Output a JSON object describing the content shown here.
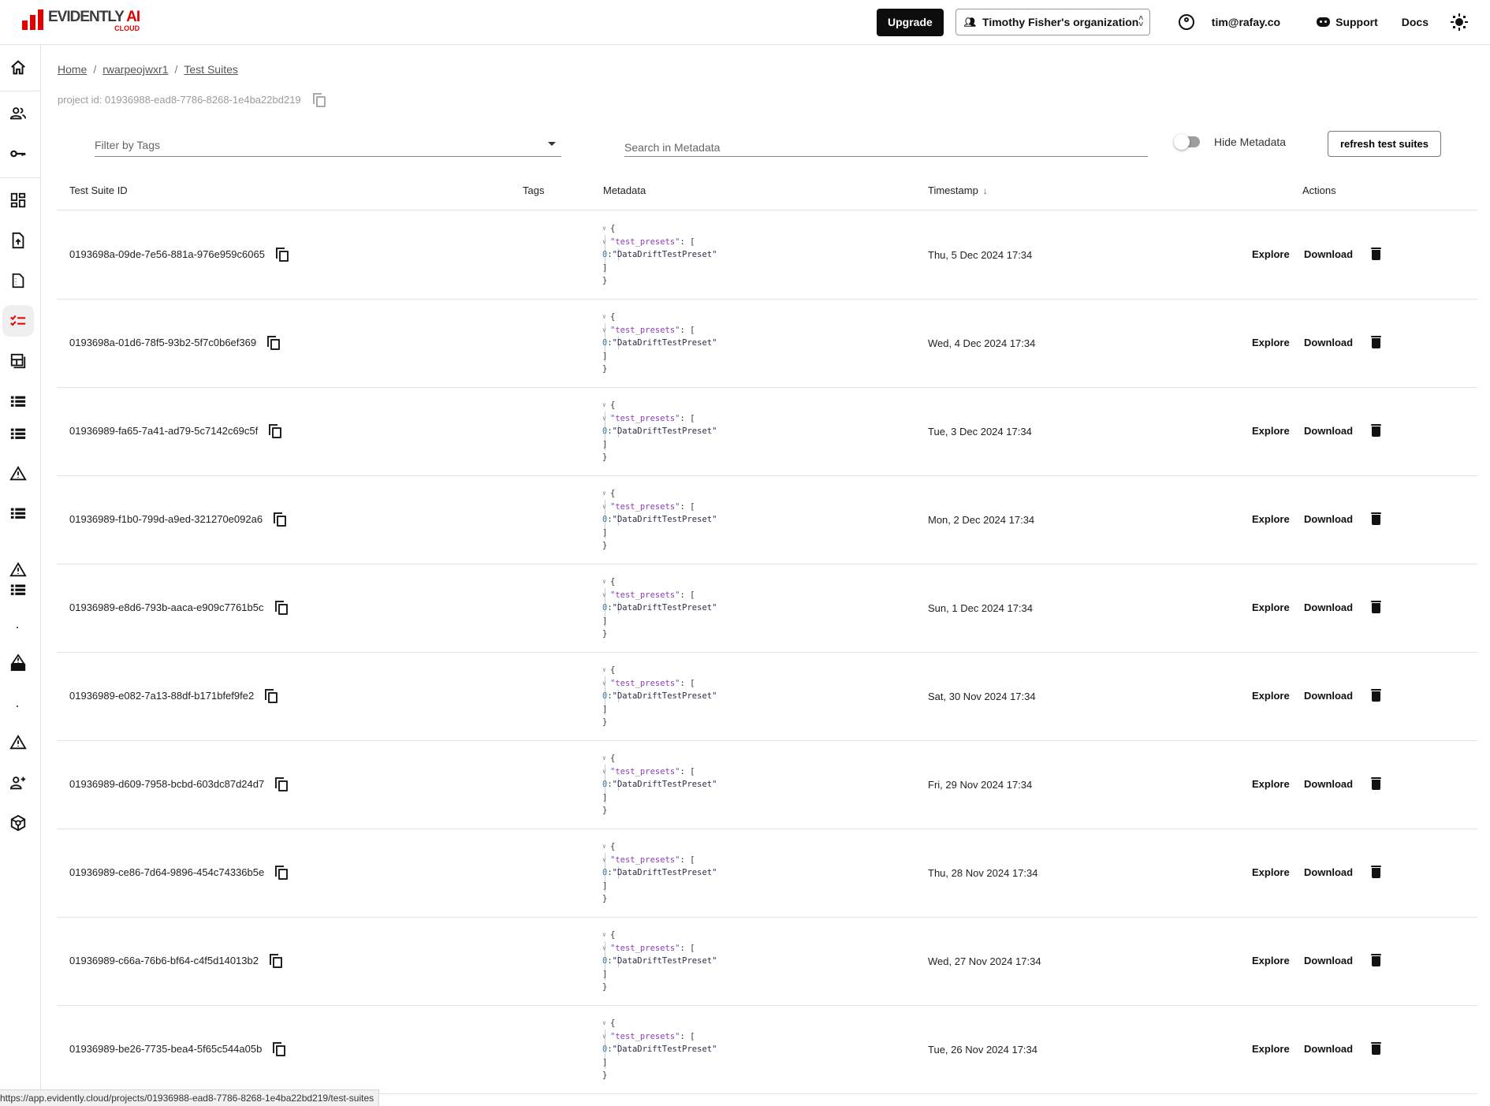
{
  "header": {
    "logo": {
      "main": "EVIDENTLY",
      "accent": "AI",
      "sub": "CLOUD",
      "brand_color": "#e10000"
    },
    "upgrade_label": "Upgrade",
    "org_selector": {
      "icon": "group-icon",
      "label": "Timothy Fisher's organization"
    },
    "account_email": "tim@rafay.co",
    "support_label": "Support",
    "docs_label": "Docs",
    "theme_icon": "sun-icon"
  },
  "sidebar": {
    "items": [
      {
        "name": "home",
        "icon": "home-icon"
      },
      {
        "name": "users",
        "icon": "users-icon"
      },
      {
        "name": "api-keys",
        "icon": "key-icon"
      },
      {
        "name": "dashboard",
        "icon": "dashboard-icon"
      },
      {
        "name": "reports",
        "icon": "upload-file-icon"
      },
      {
        "name": "datasets",
        "icon": "file-icon"
      },
      {
        "name": "test-suites",
        "icon": "checklist-icon",
        "active": true
      },
      {
        "name": "snapshots",
        "icon": "layout-icon"
      },
      {
        "name": "list-1",
        "icon": "list-icon"
      },
      {
        "name": "list-2",
        "icon": "list-icon"
      },
      {
        "name": "alerts-1",
        "icon": "warning-icon"
      },
      {
        "name": "list-3",
        "icon": "list-icon"
      },
      {
        "name": "alerts-2",
        "icon": "warning-icon"
      },
      {
        "name": "list-4",
        "icon": "list-icon"
      },
      {
        "name": "alerts-list",
        "icon": "warning-list-icon"
      },
      {
        "name": "alerts-3",
        "icon": "warning-icon"
      },
      {
        "name": "invite",
        "icon": "add-user-icon"
      },
      {
        "name": "models",
        "icon": "cube-icon"
      }
    ],
    "active_color": "#e10000"
  },
  "breadcrumb": [
    {
      "label": "Home"
    },
    {
      "label": "rwarpeojwxr1"
    },
    {
      "label": "Test Suites"
    }
  ],
  "breadcrumb_separator": "/",
  "project_id_text": "project id: 01936988-ead8-7786-8268-1e4ba22bd219",
  "filters": {
    "tags_placeholder": "Filter by Tags",
    "search_placeholder": "Search in Metadata",
    "search_value": "",
    "hide_metadata_label": "Hide Metadata",
    "hide_metadata_on": false,
    "refresh_label": "refresh test suites"
  },
  "table": {
    "columns": {
      "id": "Test Suite ID",
      "tags": "Tags",
      "metadata": "Metadata",
      "timestamp": "Timestamp",
      "timestamp_sort": "↓",
      "actions": "Actions"
    },
    "action_labels": {
      "explore": "Explore",
      "download": "Download"
    },
    "metadata_template": {
      "open_brace": "{",
      "key": "\"test_presets\"",
      "colon_bracket": ": [",
      "index": "0",
      "value": "\"DataDriftTestPreset\"",
      "close_bracket": "]",
      "close_brace": "}"
    },
    "rows": [
      {
        "id": "0193698a-09de-7e56-881a-976e959c6065",
        "tags": "",
        "timestamp": "Thu, 5 Dec 2024 17:34"
      },
      {
        "id": "0193698a-01d6-78f5-93b2-5f7c0b6ef369",
        "tags": "",
        "timestamp": "Wed, 4 Dec 2024 17:34"
      },
      {
        "id": "01936989-fa65-7a41-ad79-5c7142c69c5f",
        "tags": "",
        "timestamp": "Tue, 3 Dec 2024 17:34"
      },
      {
        "id": "01936989-f1b0-799d-a9ed-321270e092a6",
        "tags": "",
        "timestamp": "Mon, 2 Dec 2024 17:34"
      },
      {
        "id": "01936989-e8d6-793b-aaca-e909c7761b5c",
        "tags": "",
        "timestamp": "Sun, 1 Dec 2024 17:34"
      },
      {
        "id": "01936989-e082-7a13-88df-b171bfef9fe2",
        "tags": "",
        "timestamp": "Sat, 30 Nov 2024 17:34"
      },
      {
        "id": "01936989-d609-7958-bcbd-603dc87d24d7",
        "tags": "",
        "timestamp": "Fri, 29 Nov 2024 17:34"
      },
      {
        "id": "01936989-ce86-7d64-9896-454c74336b5e",
        "tags": "",
        "timestamp": "Thu, 28 Nov 2024 17:34"
      },
      {
        "id": "01936989-c66a-76b6-bf64-c4f5d14013b2",
        "tags": "",
        "timestamp": "Wed, 27 Nov 2024 17:34"
      },
      {
        "id": "01936989-be26-7735-bea4-5f65c544a05b",
        "tags": "",
        "timestamp": "Tue, 26 Nov 2024 17:34"
      }
    ]
  },
  "status_bar_url": "https://app.evidently.cloud/projects/01936988-ead8-7786-8268-1e4ba22bd219/test-suites"
}
